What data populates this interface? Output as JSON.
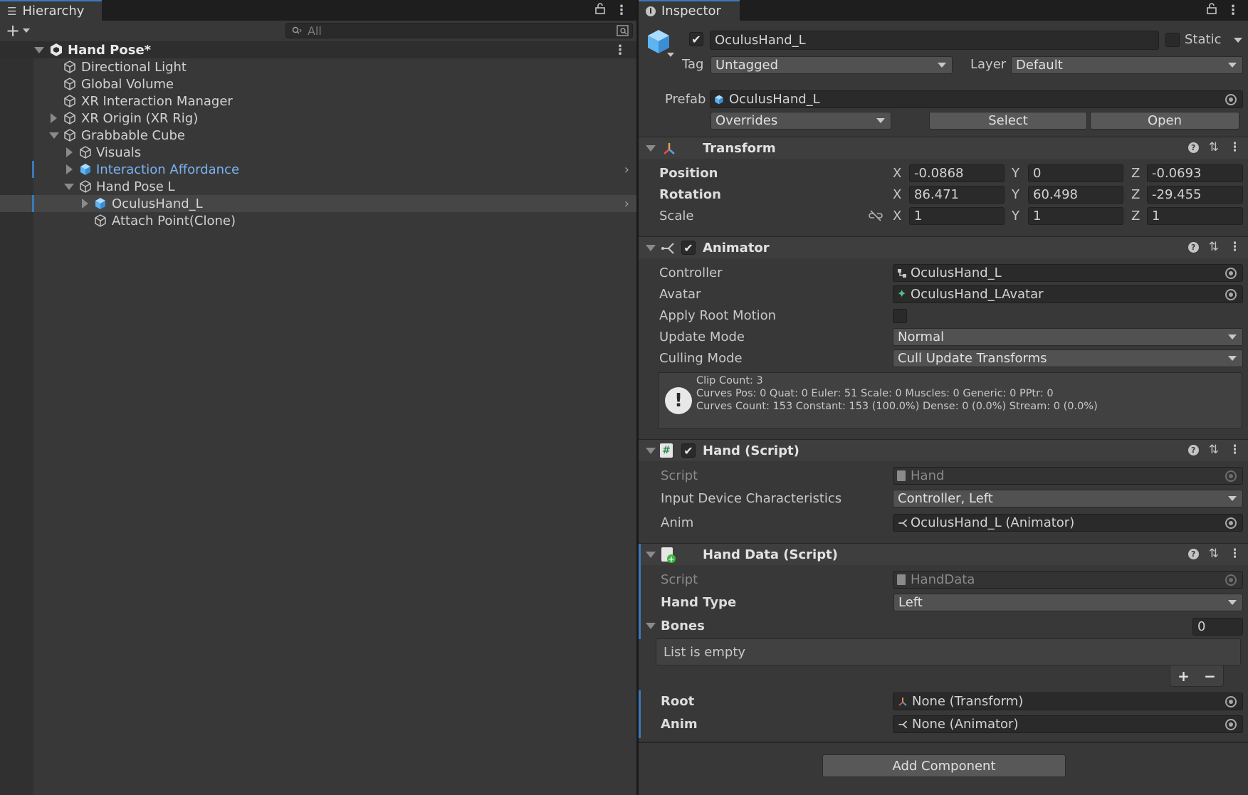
{
  "hierarchy": {
    "tab_title": "Hierarchy",
    "search_placeholder": "All",
    "scene_name": "Hand Pose*",
    "items": [
      {
        "label": "Directional Light"
      },
      {
        "label": "Global Volume"
      },
      {
        "label": "XR Interaction Manager"
      },
      {
        "label": "XR Origin (XR Rig)"
      },
      {
        "label": "Grabbable Cube"
      },
      {
        "label": "Visuals"
      },
      {
        "label": "Interaction Affordance"
      },
      {
        "label": "Hand Pose L"
      },
      {
        "label": "OculusHand_L"
      },
      {
        "label": "Attach Point(Clone)"
      }
    ]
  },
  "inspector": {
    "tab_title": "Inspector",
    "object_name": "OculusHand_L",
    "static_label": "Static",
    "tag_label": "Tag",
    "tag_value": "Untagged",
    "layer_label": "Layer",
    "layer_value": "Default",
    "prefab_label": "Prefab",
    "prefab_value": "OculusHand_L",
    "overrides_label": "Overrides",
    "select_label": "Select",
    "open_label": "Open",
    "transform": {
      "title": "Transform",
      "position_label": "Position",
      "rotation_label": "Rotation",
      "scale_label": "Scale",
      "position": {
        "x": "-0.0868",
        "y": "0",
        "z": "-0.0693"
      },
      "rotation": {
        "x": "86.471",
        "y": "60.498",
        "z": "-29.455"
      },
      "scale": {
        "x": "1",
        "y": "1",
        "z": "1"
      },
      "axis_x": "X",
      "axis_y": "Y",
      "axis_z": "Z"
    },
    "animator": {
      "title": "Animator",
      "controller_label": "Controller",
      "controller_value": "OculusHand_L",
      "avatar_label": "Avatar",
      "avatar_value": "OculusHand_LAvatar",
      "apply_root_motion_label": "Apply Root Motion",
      "update_mode_label": "Update Mode",
      "update_mode_value": "Normal",
      "culling_mode_label": "Culling Mode",
      "culling_mode_value": "Cull Update Transforms",
      "info_line1": "Clip Count: 3",
      "info_line2": "Curves Pos: 0 Quat: 0 Euler: 51 Scale: 0 Muscles: 0 Generic: 0 PPtr: 0",
      "info_line3": "Curves Count: 153 Constant: 153 (100.0%) Dense: 0 (0.0%) Stream: 0 (0.0%)"
    },
    "hand_script": {
      "title": "Hand (Script)",
      "script_label": "Script",
      "script_value": "Hand",
      "idc_label": "Input Device Characteristics",
      "idc_value": "Controller, Left",
      "anim_label": "Anim",
      "anim_value": "OculusHand_L (Animator)"
    },
    "hand_data": {
      "title": "Hand Data (Script)",
      "script_label": "Script",
      "script_value": "HandData",
      "hand_type_label": "Hand Type",
      "hand_type_value": "Left",
      "bones_label": "Bones",
      "bones_count": "0",
      "list_empty": "List is empty",
      "plus": "+",
      "minus": "−",
      "root_label": "Root",
      "root_value": "None (Transform)",
      "anim_label": "Anim",
      "anim_value": "None (Animator)"
    },
    "add_component_label": "Add Component"
  }
}
